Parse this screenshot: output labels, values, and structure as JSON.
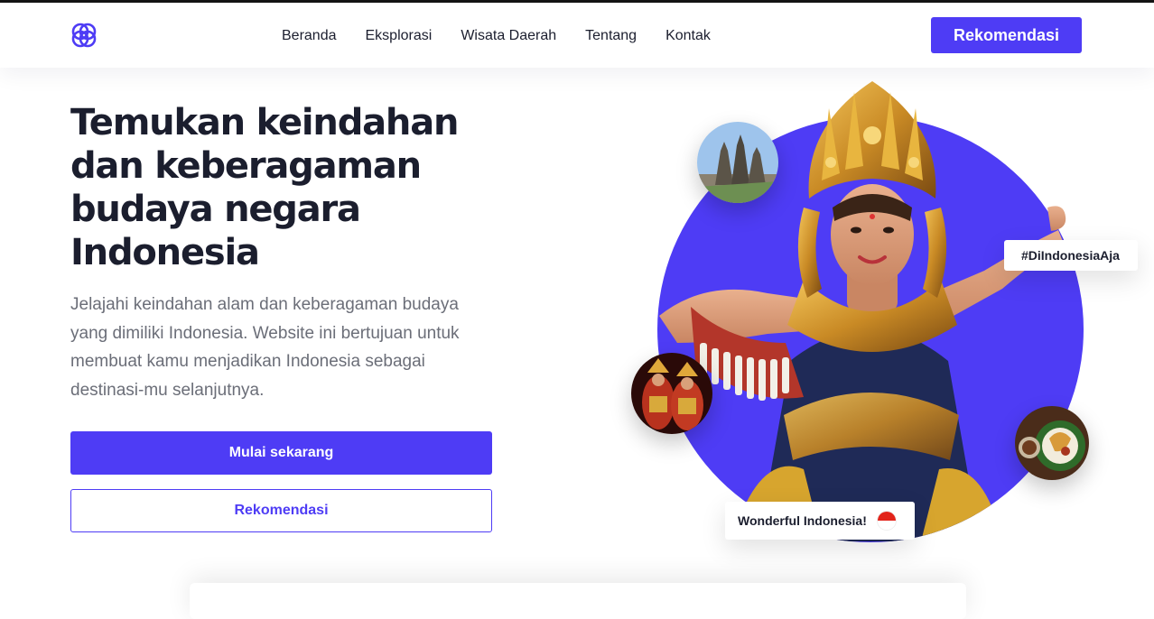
{
  "header": {
    "logo_icon": "interlocking-loops-logo-icon",
    "nav": [
      "Beranda",
      "Eksplorasi",
      "Wisata Daerah",
      "Tentang",
      "Kontak"
    ],
    "cta_label": "Rekomendasi"
  },
  "hero": {
    "title": "Temukan keindahan dan keberagaman budaya negara Indonesia",
    "description": "Jelajahi keindahan alam dan keberagaman budaya yang dimiliki Indonesia. Website ini bertujuan untuk membuat kamu menjadikan Indonesia sebagai destinasi-mu selanjutnya.",
    "primary_button": "Mulai sekarang",
    "secondary_button": "Rekomendasi"
  },
  "visual": {
    "hashtag": "#DiIndonesiaAja",
    "badge": "Wonderful Indonesia!",
    "badge_icon": "indonesia-flag-icon",
    "images": [
      "temple-photo",
      "balinese-dancer-photo",
      "dance-performance-photo",
      "food-photo"
    ]
  },
  "colors": {
    "accent": "#4e3cf5",
    "heading": "#1b1e2e",
    "body_text": "#6b6e78",
    "flag_red": "#e2231a"
  }
}
